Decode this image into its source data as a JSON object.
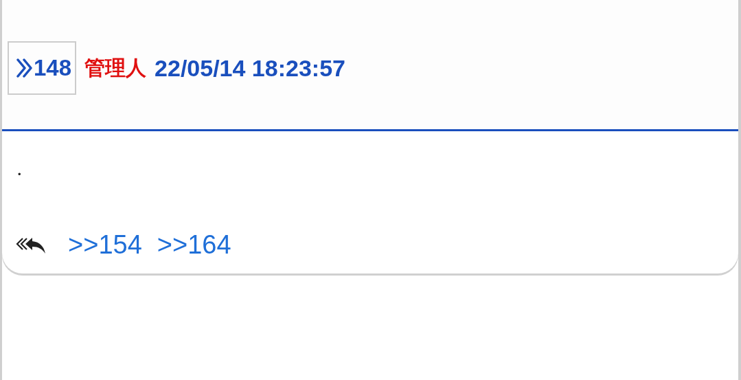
{
  "post": {
    "number": "148",
    "author": "管理人",
    "datetime": "22/05/14 18:23:57",
    "body": "・",
    "replies": [
      ">>154",
      ">>164"
    ]
  }
}
